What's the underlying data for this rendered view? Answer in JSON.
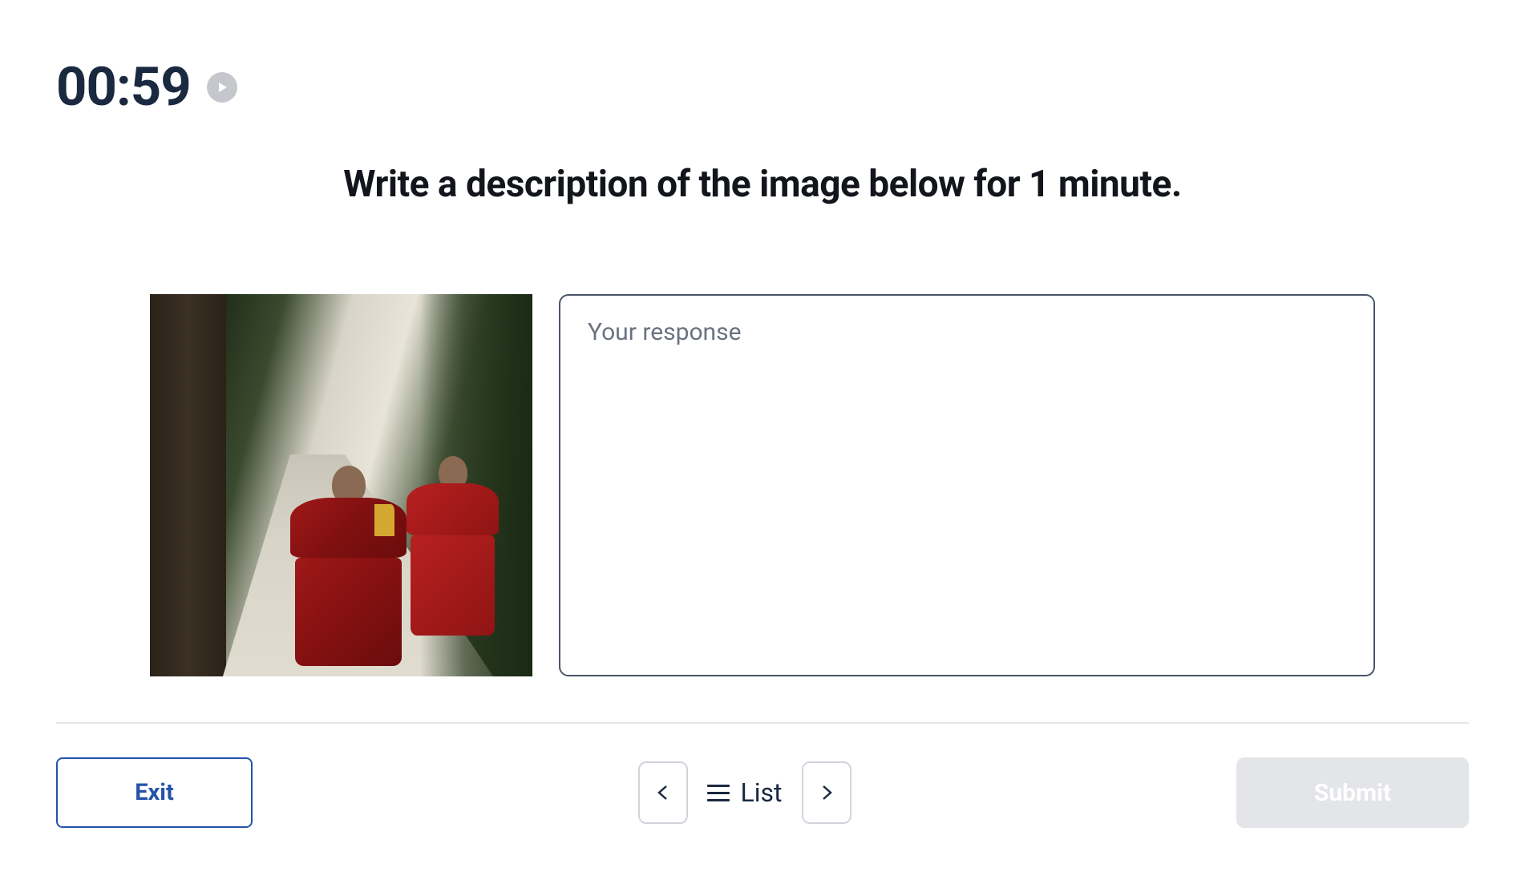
{
  "timer": {
    "value": "00:59"
  },
  "prompt": {
    "text": "Write a description of the image below for 1 minute."
  },
  "response": {
    "placeholder": "Your response",
    "value": ""
  },
  "footer": {
    "exit_label": "Exit",
    "list_label": "List",
    "submit_label": "Submit"
  }
}
